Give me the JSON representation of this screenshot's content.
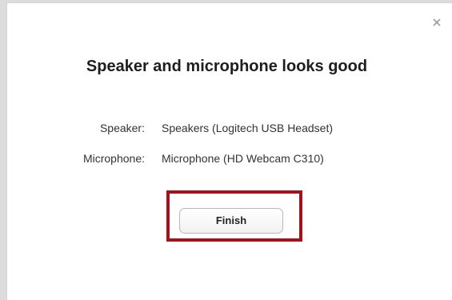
{
  "dialog": {
    "title": "Speaker and microphone looks good",
    "close_icon": "close-icon",
    "speaker": {
      "label": "Speaker:",
      "value": "Speakers (Logitech USB Headset)"
    },
    "microphone": {
      "label": "Microphone:",
      "value": "Microphone (HD Webcam C310)"
    },
    "finish_label": "Finish"
  },
  "colors": {
    "highlight_border": "#a0151d",
    "title_text": "#1e1e1e"
  }
}
